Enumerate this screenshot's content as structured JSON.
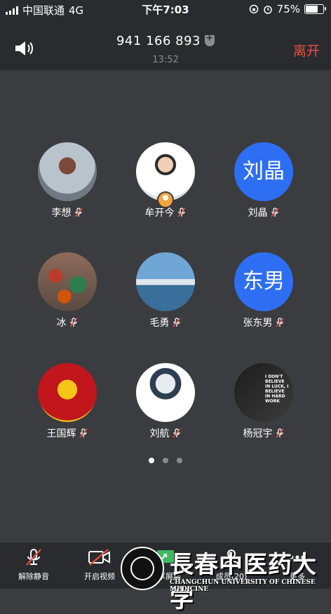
{
  "status_bar": {
    "carrier": "中国联通",
    "network": "4G",
    "time": "下午7:03",
    "battery_percent": "75%",
    "battery_level": 0.75
  },
  "header": {
    "meeting_id": "941 166 893",
    "duration": "13:52",
    "leave_label": "离开",
    "speaker_icon": "speaker-icon",
    "shield_icon": "shield-icon"
  },
  "participants": [
    {
      "name": "李想",
      "avatar_type": "photo",
      "avatar_text": ""
    },
    {
      "name": "牟开今",
      "avatar_type": "photo",
      "avatar_text": "",
      "host": true
    },
    {
      "name": "刘晶",
      "avatar_type": "text",
      "avatar_text": "刘晶"
    },
    {
      "name": "冰",
      "avatar_type": "photo",
      "avatar_text": ""
    },
    {
      "name": "毛勇",
      "avatar_type": "photo",
      "avatar_text": ""
    },
    {
      "name": "张东男",
      "avatar_type": "text",
      "avatar_text": "东男"
    },
    {
      "name": "王国辉",
      "avatar_type": "photo",
      "avatar_text": ""
    },
    {
      "name": "刘航",
      "avatar_type": "photo",
      "avatar_text": ""
    },
    {
      "name": "杨冠宇",
      "avatar_type": "photo",
      "avatar_text": "I DON'T BELIEVE IN LUCK, I BELIEVE IN HARD WORK"
    }
  ],
  "pagination": {
    "pages": 3,
    "current": 0
  },
  "toolbar": {
    "unmute": "解除静音",
    "start_video": "开启视频",
    "share_screen": "共享屏幕",
    "members": "成员(20)",
    "more": "更多"
  },
  "watermark": {
    "chinese": "長春中医药大学",
    "english": "CHANGCHUN UNIVERSITY OF CHINESE MEDICINE"
  },
  "colors": {
    "background": "#3b3c40",
    "bar": "#2a2b2f",
    "leave": "#e8513b",
    "avatar_blue": "#2e6ef2",
    "mute_red": "#e8513b"
  }
}
